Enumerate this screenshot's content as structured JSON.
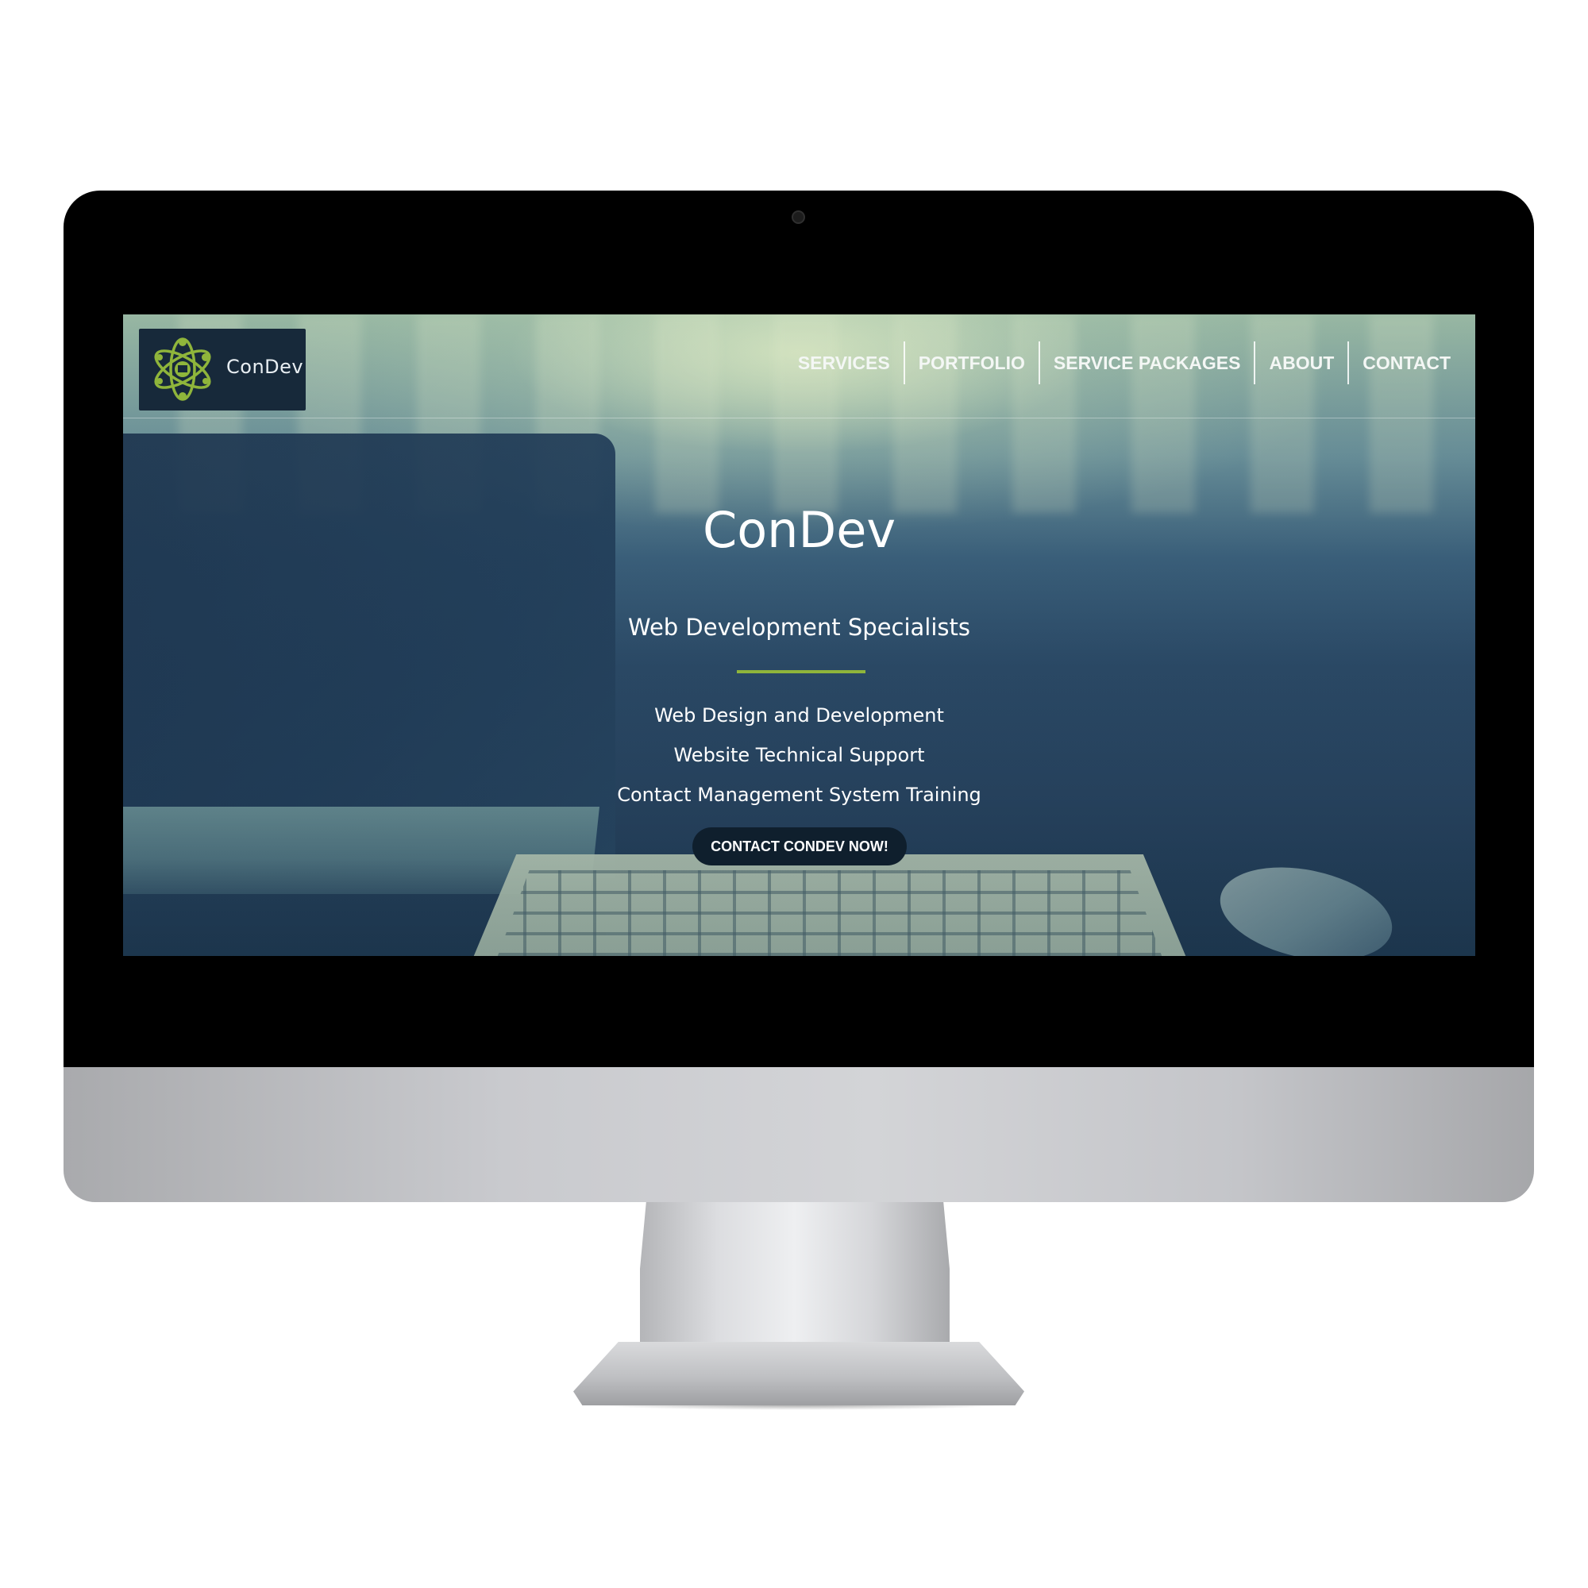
{
  "brand": {
    "name": "ConDev",
    "logo_color": "#8fb53b",
    "logo_box_color": "#17293a"
  },
  "nav": {
    "items": [
      {
        "label": "SERVICES"
      },
      {
        "label": "PORTFOLIO"
      },
      {
        "label": "SERVICE PACKAGES"
      },
      {
        "label": "ABOUT"
      },
      {
        "label": "CONTACT"
      }
    ]
  },
  "hero": {
    "title": "ConDev",
    "subtitle": "Web Development Specialists",
    "divider_color": "#8fb53b",
    "services": [
      "Web Design and Development",
      "Website Technical Support",
      "Contact Management System Training"
    ],
    "cta_label": "CONTACT CONDEV NOW!",
    "cta_color": "#0f1f2d"
  },
  "icons": {
    "logo": "atom-logo-icon",
    "webcam": "webcam-icon"
  }
}
